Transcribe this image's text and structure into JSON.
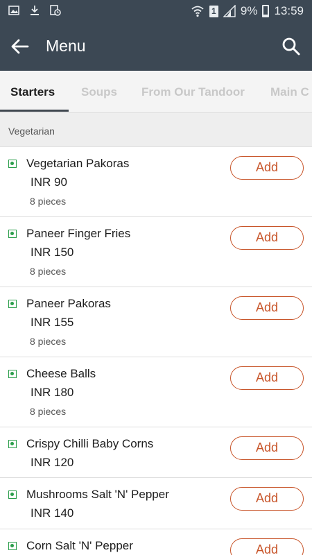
{
  "status_bar": {
    "battery_percent": "9%",
    "sim_slot": "1",
    "time": "13:59",
    "icons": [
      "gallery-icon",
      "download-icon",
      "clock-doc-icon",
      "wifi-icon",
      "signal-icon",
      "battery-icon"
    ]
  },
  "app_bar": {
    "title": "Menu",
    "back_icon": "arrow-left-icon",
    "search_icon": "search-icon",
    "bg_color": "#3c4854"
  },
  "tabs": [
    {
      "label": "Starters",
      "active": true
    },
    {
      "label": "Soups",
      "active": false
    },
    {
      "label": "From Our Tandoor",
      "active": false
    },
    {
      "label": "Main C",
      "active": false
    }
  ],
  "section": {
    "label": "Vegetarian"
  },
  "items": [
    {
      "name": "Vegetarian Pakoras",
      "price": "INR 90",
      "description": "8 pieces",
      "add_label": "Add",
      "veg": true
    },
    {
      "name": "Paneer Finger Fries",
      "price": "INR 150",
      "description": "8 pieces",
      "add_label": "Add",
      "veg": true
    },
    {
      "name": "Paneer Pakoras",
      "price": "INR 155",
      "description": "8 pieces",
      "add_label": "Add",
      "veg": true
    },
    {
      "name": "Cheese Balls",
      "price": "INR 180",
      "description": "8 pieces",
      "add_label": "Add",
      "veg": true
    },
    {
      "name": "Crispy Chilli Baby Corns",
      "price": "INR 120",
      "description": "",
      "add_label": "Add",
      "veg": true
    },
    {
      "name": "Mushrooms Salt 'N' Pepper",
      "price": "INR 140",
      "description": "",
      "add_label": "Add",
      "veg": true
    },
    {
      "name": "Corn Salt 'N' Pepper",
      "price": "",
      "description": "",
      "add_label": "Add",
      "veg": true
    }
  ],
  "colors": {
    "accent": "#c8552a",
    "veg_green": "#2a9d4a"
  }
}
